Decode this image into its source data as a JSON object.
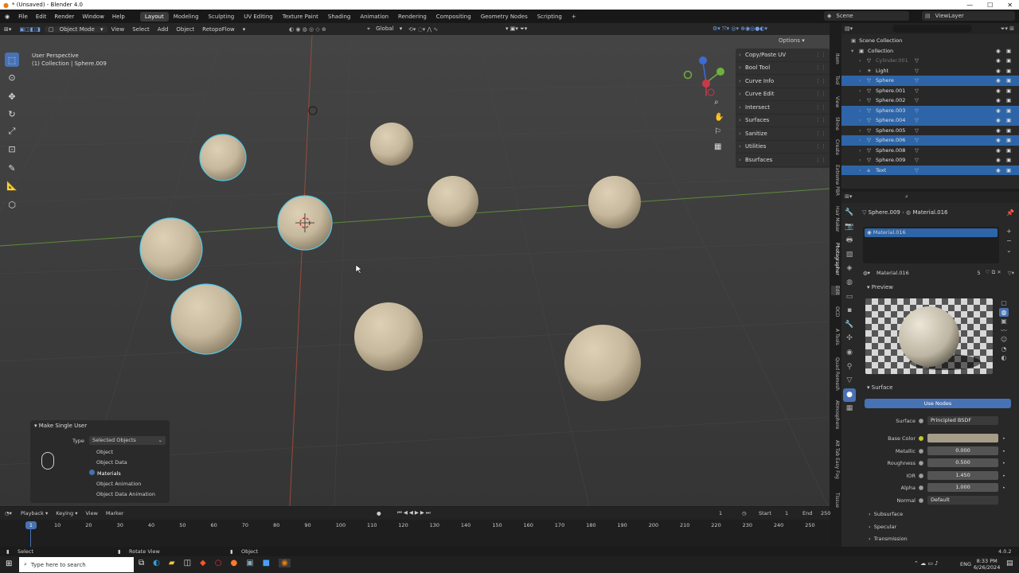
{
  "window": {
    "title": "* (Unsaved) - Blender 4.0",
    "controls": [
      "—",
      "☐",
      "✕"
    ]
  },
  "menu": {
    "items": [
      "File",
      "Edit",
      "Render",
      "Window",
      "Help"
    ]
  },
  "workspaces": [
    "Layout",
    "Modeling",
    "Sculpting",
    "UV Editing",
    "Texture Paint",
    "Shading",
    "Animation",
    "Rendering",
    "Compositing",
    "Geometry Nodes",
    "Scripting",
    "+"
  ],
  "scene": {
    "label": "Scene",
    "viewlayer": "ViewLayer"
  },
  "viewport_header": {
    "mode": "Object Mode",
    "menus": [
      "View",
      "Select",
      "Add",
      "Object",
      "RetopoFlow"
    ],
    "transform": "Global",
    "options": "Options"
  },
  "viewport": {
    "perspective": "User Perspective",
    "context": "(1) Collection | Sphere.009"
  },
  "npanel": {
    "items": [
      "Copy/Paste UV",
      "Bool Tool",
      "Curve Info",
      "Curve Edit",
      "Intersect",
      "Surfaces",
      "Sanitize",
      "Utilities",
      "Bsurfaces"
    ]
  },
  "vtabs": [
    "Item",
    "Tool",
    "View",
    "Shine",
    "Create",
    "Extreme PBR",
    "Hair Maker",
    "Photographer",
    "Edit",
    "OCD",
    "A Tools",
    "Quad Remesh",
    "Atmosphere",
    "Alt Tab Easy Fog",
    "Tissue"
  ],
  "redo_panel": {
    "title": "Make Single User",
    "type_label": "Type",
    "type_value": "Selected Objects",
    "options": [
      {
        "label": "Object",
        "on": false
      },
      {
        "label": "Object Data",
        "on": false
      },
      {
        "label": "Materials",
        "on": true
      },
      {
        "label": "Object Animation",
        "on": false
      },
      {
        "label": "Object Data Animation",
        "on": false
      }
    ]
  },
  "outliner": {
    "root": "Scene Collection",
    "rows": [
      {
        "name": "Collection",
        "selected": false,
        "faded": false
      },
      {
        "name": "Cylinder.001",
        "selected": false,
        "faded": true
      },
      {
        "name": "Light",
        "selected": false,
        "faded": false
      },
      {
        "name": "Sphere",
        "selected": true,
        "faded": false
      },
      {
        "name": "Sphere.001",
        "selected": false,
        "faded": false
      },
      {
        "name": "Sphere.002",
        "selected": false,
        "faded": false
      },
      {
        "name": "Sphere.003",
        "selected": true,
        "faded": false
      },
      {
        "name": "Sphere.004",
        "selected": true,
        "faded": false
      },
      {
        "name": "Sphere.005",
        "selected": false,
        "faded": false
      },
      {
        "name": "Sphere.006",
        "selected": true,
        "faded": false
      },
      {
        "name": "Sphere.008",
        "selected": false,
        "faded": false
      },
      {
        "name": "Sphere.009",
        "selected": false,
        "faded": false
      },
      {
        "name": "Text",
        "selected": true,
        "faded": false
      }
    ]
  },
  "properties": {
    "breadcrumb_object": "Sphere.009",
    "breadcrumb_material": "Material.016",
    "slot_name": "Material.016",
    "material_name": "Material.016",
    "users": "5",
    "preview_label": "Preview",
    "surface_label": "Surface",
    "use_nodes": "Use Nodes",
    "fields": [
      {
        "label": "Surface",
        "value": "Principled BSDF"
      },
      {
        "label": "Base Color",
        "value": ""
      },
      {
        "label": "Metallic",
        "value": "0.000"
      },
      {
        "label": "Roughness",
        "value": "0.500"
      },
      {
        "label": "IOR",
        "value": "1.450"
      },
      {
        "label": "Alpha",
        "value": "1.000"
      },
      {
        "label": "Normal",
        "value": "Default"
      }
    ],
    "subpanels": [
      "Subsurface",
      "Specular",
      "Transmission"
    ],
    "base_color": "#a59d88"
  },
  "timeline": {
    "menus": [
      "Playback",
      "Keying",
      "View",
      "Marker"
    ],
    "current_frame": "1",
    "start_label": "Start",
    "start": "1",
    "end_label": "End",
    "end": "250",
    "ticks": [
      "10",
      "20",
      "30",
      "40",
      "50",
      "60",
      "70",
      "80",
      "90",
      "100",
      "110",
      "120",
      "130",
      "140",
      "150",
      "160",
      "170",
      "180",
      "190",
      "200",
      "210",
      "220",
      "230",
      "240",
      "250"
    ]
  },
  "statusbar": {
    "select": "Select",
    "rotate": "Rotate View",
    "object": "Object",
    "version": "4.0.2"
  },
  "taskbar": {
    "search": "Type here to search",
    "lang": "ENG",
    "time": "8:33 PM",
    "date": "6/26/2024"
  },
  "colors": {
    "accent": "#4772b3",
    "selected_row": "#2e65a8",
    "outline": "#52c8e8",
    "sphere": "#cdbfa4"
  }
}
